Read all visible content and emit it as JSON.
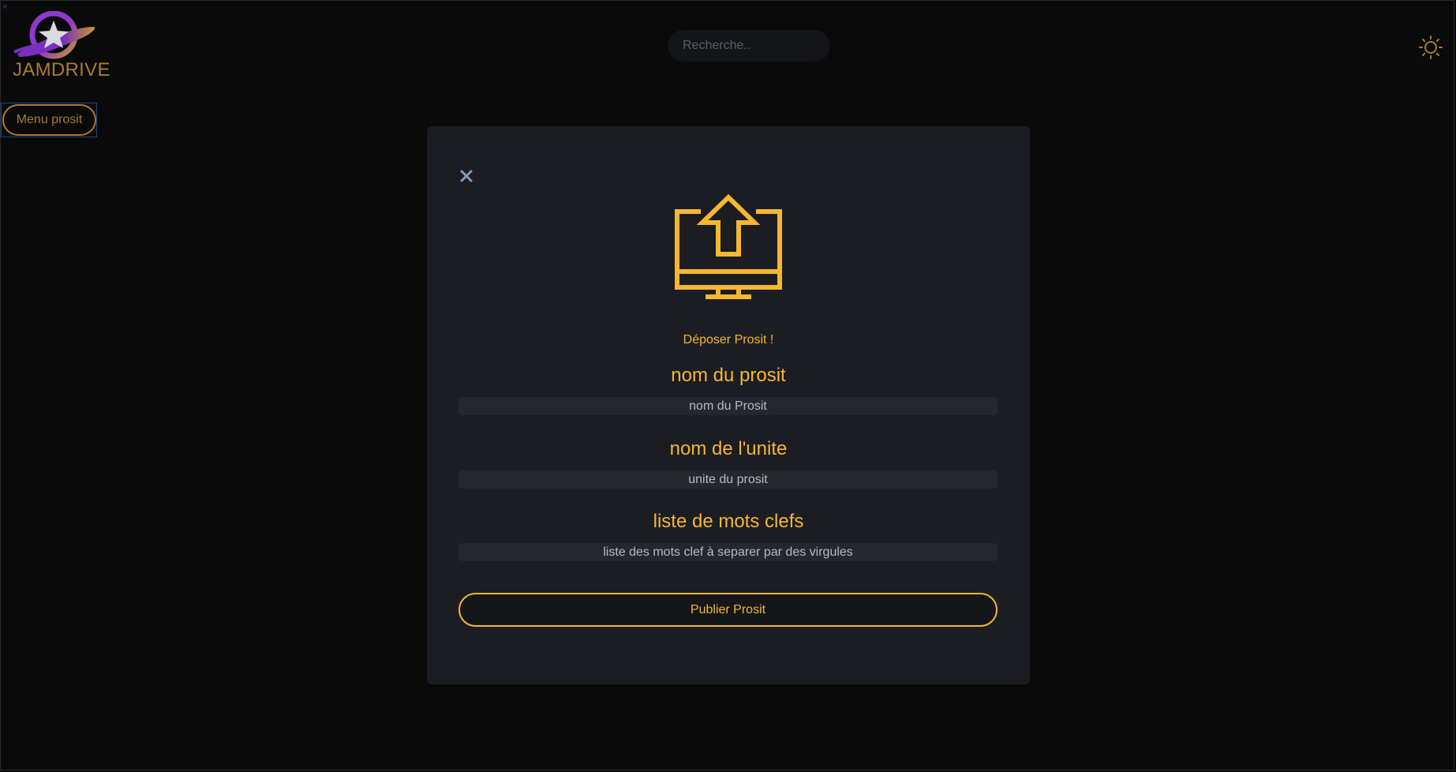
{
  "app": {
    "logo_text": "JAMDRIVE",
    "corner_mark": "×"
  },
  "header": {
    "search_placeholder": "Recherche..",
    "theme_toggle_icon": "sun-icon"
  },
  "nav": {
    "menu_button_label": "Menu prosit"
  },
  "modal": {
    "close_icon": "close-icon",
    "upload_icon": "monitor-upload-icon",
    "subtitle": "Déposer Prosit !",
    "fields": [
      {
        "label": "nom du prosit",
        "placeholder": "nom du Prosit",
        "value": ""
      },
      {
        "label": "nom de l'unite",
        "placeholder": "unite du prosit",
        "value": ""
      },
      {
        "label": "liste de mots clefs",
        "placeholder": "liste des mots clef à separer par des virgules",
        "value": ""
      }
    ],
    "submit_label": "Publier Prosit"
  },
  "colors": {
    "background": "#0a0a0b",
    "modal_background": "#1c1d22",
    "accent": "#f5b731",
    "accent_dim": "#a87c2c",
    "input_background": "#26272d",
    "logo_purple": "#7b2fbf"
  }
}
